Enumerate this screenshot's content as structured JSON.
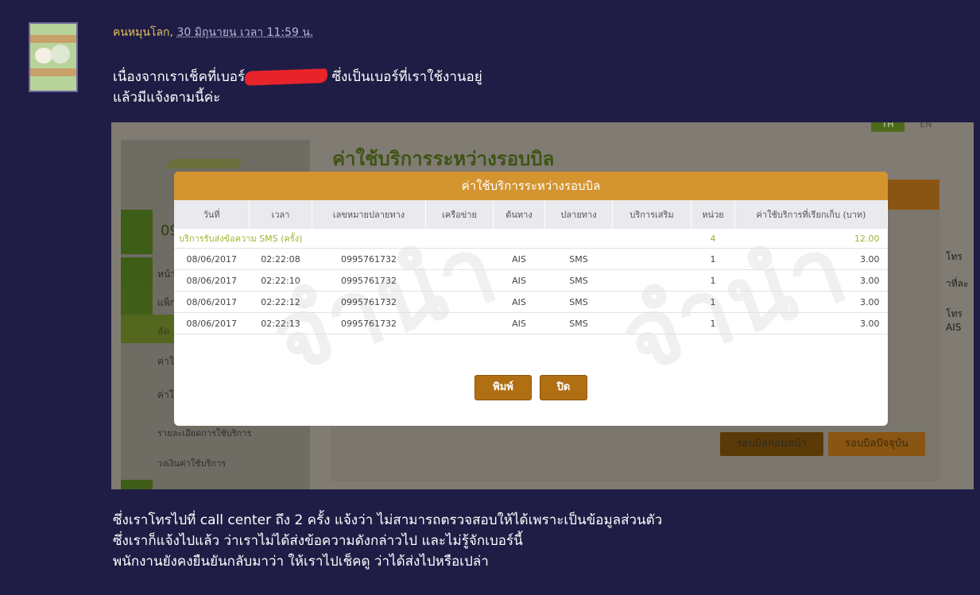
{
  "post": {
    "username": "คนหมุนโลก",
    "separator": ",",
    "datetime": "30 มิถุนายน เวลา 11:59 น.",
    "intro_before_redaction": "เนื่องจากเราเช็คที่เบอร์",
    "intro_after_redaction": "ซึ่งเป็นเบอร์ที่เราใช้งานอยู่",
    "intro_line2": "แล้วมีแจ้งตามนี้ค่ะ",
    "body_line1": "ซึ่งเราโทรไปที่ call center ถึง 2 ครั้ง แจ้งว่า ไม่สามารถตรวจสอบให้ได้เพราะเป็นข้อมูลส่วนตัว",
    "body_line2": "ซึ่งเราก็แจ้งไปแล้ว ว่าเราไม่ได้ส่งข้อความดังกล่าวไป และไม่รู้จักเบอร์นี้",
    "body_line3": "พนักงานยังคงยืนยันกลับมาว่า ให้เราไปเช็คดู ว่าได้ส่งไปหรือเปล่า"
  },
  "screenshot": {
    "page_heading": "ค่าใช้บริการระหว่างรอบบิล",
    "side_number": "09",
    "sidebar_items": [
      "หน้า",
      "แพ็ก",
      "ลัด",
      "ค่าใ",
      "ค่าใ",
      "รายละเอียดการใช้บริการ",
      "วงเงินค่าใช้บริการ"
    ],
    "right_fragments": [
      "โทร",
      "าที่ละ",
      "โทร AIS"
    ],
    "lang_th": "TH",
    "lang_en": "EN",
    "btn_prev_cycle": "รอบบิลก่อนหน้า",
    "btn_current_cycle": "รอบบิลปัจจุบัน",
    "watermark": "จำนำ",
    "modal": {
      "title": "ค่าใช้บริการระหว่างรอบบิล",
      "columns": [
        "วันที่",
        "เวลา",
        "เลขหมายปลายทาง",
        "เครือข่าย",
        "ต้นทาง",
        "ปลายทาง",
        "บริการเสริม",
        "หน่วย",
        "ค่าใช้บริการที่เรียกเก็บ (บาท)"
      ],
      "category": {
        "label": "บริการรับส่งข้อความ SMS (ครั้ง)",
        "units": "4",
        "amount": "12.00"
      },
      "rows": [
        {
          "date": "08/06/2017",
          "time": "02:22:08",
          "number": "0995761732",
          "network": "",
          "origin": "AIS",
          "dest": "SMS",
          "extra": "",
          "units": "1",
          "amount": "3.00"
        },
        {
          "date": "08/06/2017",
          "time": "02:22:10",
          "number": "0995761732",
          "network": "",
          "origin": "AIS",
          "dest": "SMS",
          "extra": "",
          "units": "1",
          "amount": "3.00"
        },
        {
          "date": "08/06/2017",
          "time": "02:22:12",
          "number": "0995761732",
          "network": "",
          "origin": "AIS",
          "dest": "SMS",
          "extra": "",
          "units": "1",
          "amount": "3.00"
        },
        {
          "date": "08/06/2017",
          "time": "02:22:13",
          "number": "0995761732",
          "network": "",
          "origin": "AIS",
          "dest": "SMS",
          "extra": "",
          "units": "1",
          "amount": "3.00"
        }
      ],
      "print_label": "พิมพ์",
      "close_label": "ปิด"
    }
  }
}
